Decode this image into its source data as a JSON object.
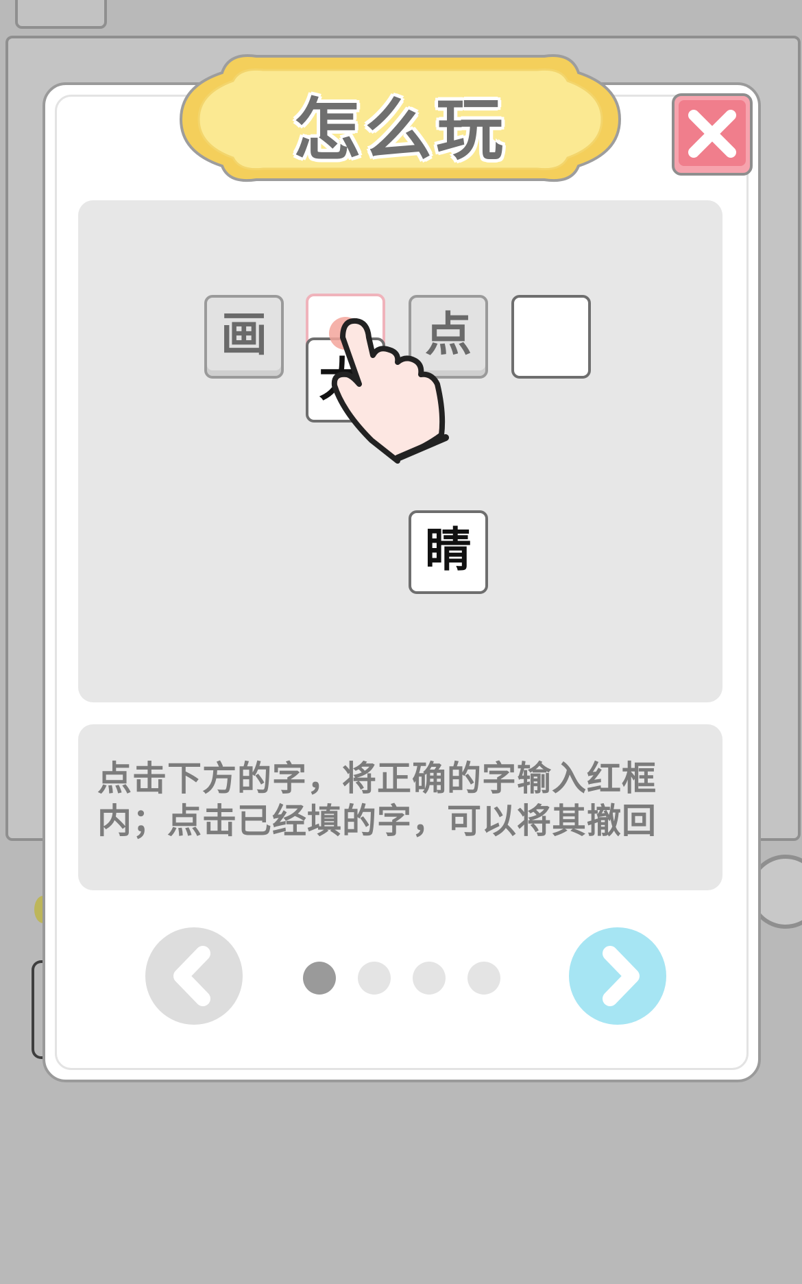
{
  "dialog": {
    "title": "怎么玩",
    "close_icon": "close-x-icon",
    "instructions": "点击下方的字，将正确的字输入红框内；点击已经填的字，可以将其撤回"
  },
  "demo": {
    "tiles": [
      "画",
      "",
      "点",
      "",
      "睛"
    ],
    "hand_icon": "pointing-hand-icon"
  },
  "pagination": {
    "prev_icon": "chevron-left-icon",
    "next_icon": "chevron-right-icon",
    "total_pages": 4,
    "current_page": 1
  },
  "colors": {
    "banner_yellow": "#fbe48a",
    "close_red": "#f07e8c",
    "next_blue": "#a6e5f3",
    "overlay_grey": "#b9b9b9"
  }
}
